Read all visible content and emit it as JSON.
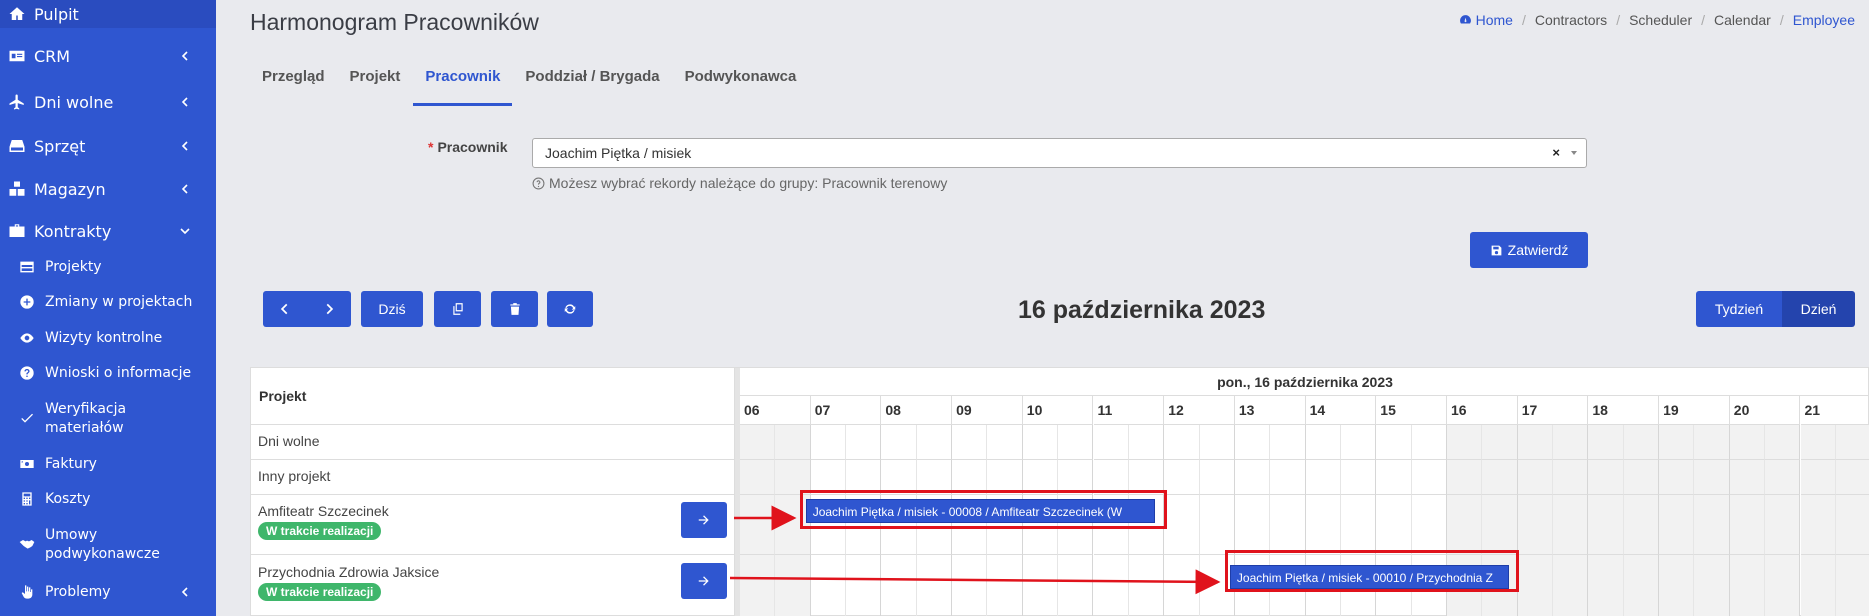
{
  "sidebar": {
    "items": [
      {
        "label": "Pulpit",
        "icon": "home-icon"
      },
      {
        "label": "CRM",
        "icon": "id-card-icon"
      },
      {
        "label": "Dni wolne",
        "icon": "plane-icon"
      },
      {
        "label": "Sprzęt",
        "icon": "hdd-icon"
      },
      {
        "label": "Magazyn",
        "icon": "cubes-icon"
      },
      {
        "label": "Kontrakty",
        "icon": "briefcase-icon"
      }
    ],
    "subitems": [
      {
        "label": "Projekty",
        "icon": "table-icon"
      },
      {
        "label": "Zmiany w projektach",
        "icon": "plus-circle-icon"
      },
      {
        "label": "Wizyty kontrolne",
        "icon": "eye-icon"
      },
      {
        "label": "Wnioski o informacje",
        "icon": "question-circle-icon"
      },
      {
        "label": "Weryfikacja materiałów",
        "icon": "check-icon"
      },
      {
        "label": "Faktury",
        "icon": "money-icon"
      },
      {
        "label": "Koszty",
        "icon": "calculator-icon"
      },
      {
        "label": "Umowy podwykonawcze",
        "icon": "handshake-icon"
      },
      {
        "label": "Problemy",
        "icon": "hand-icon"
      }
    ]
  },
  "header": {
    "title": "Harmonogram Pracowników",
    "breadcrumb": [
      "Home",
      "Contractors",
      "Scheduler",
      "Calendar",
      "Employee"
    ]
  },
  "tabs": [
    "Przegląd",
    "Projekt",
    "Pracownik",
    "Poddział / Brygada",
    "Podwykonawca"
  ],
  "active_tab": "Pracownik",
  "form": {
    "label": "Pracownik",
    "value": "Joachim Piętka / misiek",
    "clear": "×",
    "hint": "Możesz wybrać rekordy należące do grupy: Pracownik terenowy",
    "confirm": "Zatwierdź"
  },
  "toolbar": {
    "today": "Dziś",
    "date_title": "16 października 2023",
    "view_week": "Tydzień",
    "view_day": "Dzień"
  },
  "scheduler": {
    "resource_header": "Projekt",
    "day_header": "pon., 16 października 2023",
    "hours": [
      "06",
      "07",
      "08",
      "09",
      "10",
      "11",
      "12",
      "13",
      "14",
      "15",
      "16",
      "17",
      "18",
      "19",
      "20",
      "21"
    ],
    "rows": [
      {
        "name": "Dni wolne",
        "status": ""
      },
      {
        "name": "Inny projekt",
        "status": ""
      },
      {
        "name": "Amfiteatr Szczecinek",
        "status": "W trakcie realizacji"
      },
      {
        "name": "Przychodnia Zdrowia Jaksice",
        "status": "W trakcie realizacji"
      }
    ],
    "events": [
      {
        "label": "Joachim Piętka / misiek - 00008 / Amfiteatr Szczecinek (W",
        "start": "07:00",
        "end": "12:00"
      },
      {
        "label": "Joachim Piętka / misiek - 00010 / Przychodnia Z",
        "start": "13:00",
        "end": "17:00"
      }
    ]
  },
  "colors": {
    "primary": "#2f56d0",
    "badge": "#3fb66b",
    "highlight": "#e0131c"
  }
}
